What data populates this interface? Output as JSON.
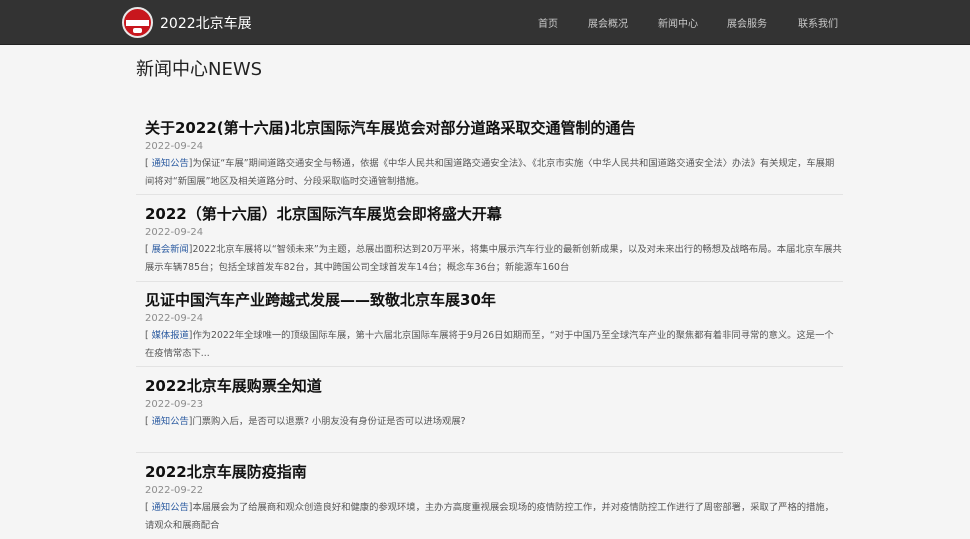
{
  "header": {
    "brand_name": "2022北京车展",
    "nav": [
      {
        "label": "首页"
      },
      {
        "label": "展会概况"
      },
      {
        "label": "新闻中心"
      },
      {
        "label": "展会服务"
      },
      {
        "label": "联系我们"
      }
    ]
  },
  "page": {
    "title": "新闻中心NEWS"
  },
  "news": [
    {
      "title": "关于2022(第十六届)北京国际汽车展览会对部分道路采取交通管制的通告",
      "date": "2022-09-24",
      "category": "通知公告",
      "summary": "为保证“车展”期间道路交通安全与畅通，依据《中华人民共和国道路交通安全法》、《北京市实施〈中华人民共和国道路交通安全法〉办法》有关规定，车展期间将对“新国展”地区及相关道路分时、分段采取临时交通管制措施。"
    },
    {
      "title": "2022（第十六届）北京国际汽车展览会即将盛大开幕",
      "date": "2022-09-24",
      "category": "展会新闻",
      "summary": "2022北京车展将以“智领未来”为主题，总展出面积达到20万平米，将集中展示汽车行业的最新创新成果，以及对未来出行的畅想及战略布局。本届北京车展共展示车辆785台；包括全球首发车82台，其中跨国公司全球首发车14台；概念车36台；新能源车160台"
    },
    {
      "title": "见证中国汽车产业跨越式发展——致敬北京车展30年",
      "date": "2022-09-24",
      "category": "媒体报道",
      "summary": "作为2022年全球唯一的顶级国际车展，第十六届北京国际车展将于9月26日如期而至，“对于中国乃至全球汽车产业的聚焦都有着非同寻常的意义。这是一个在疫情常态下..."
    },
    {
      "title": "2022北京车展购票全知道",
      "date": "2022-09-23",
      "category": "通知公告",
      "summary": "门票购入后，是否可以退票? 小朋友没有身份证是否可以进场观展?"
    },
    {
      "title": "2022北京车展防疫指南",
      "date": "2022-09-22",
      "category": "通知公告",
      "summary": "本届展会为了给展商和观众创造良好和健康的参观环境，主办方高度重视展会现场的疫情防控工作，并对疫情防控工作进行了周密部署，采取了严格的措施，请观众和展商配合"
    }
  ]
}
